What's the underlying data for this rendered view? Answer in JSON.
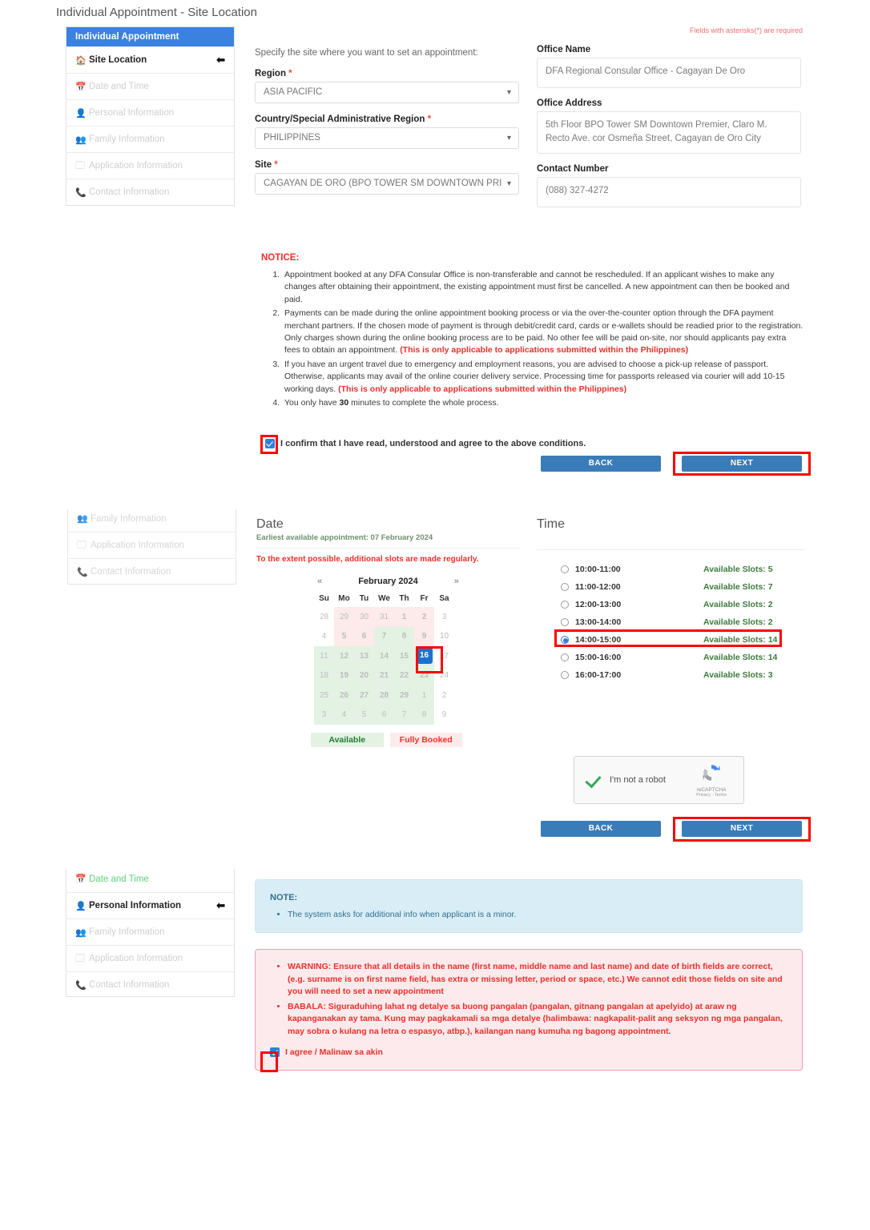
{
  "page": {
    "title": "Individual Appointment - Site Location",
    "required_note": "Fields with asterisks(*) are required"
  },
  "sidebar": {
    "header": "Individual Appointment",
    "items": [
      {
        "label": "Site Location",
        "icon": "home-icon",
        "state": "active"
      },
      {
        "label": "Date and Time",
        "icon": "calendar-icon",
        "state": "disabled"
      },
      {
        "label": "Personal Information",
        "icon": "user-icon",
        "state": "disabled"
      },
      {
        "label": "Family Information",
        "icon": "family-icon",
        "state": "disabled"
      },
      {
        "label": "Application Information",
        "icon": "card-icon",
        "state": "disabled"
      },
      {
        "label": "Contact Information",
        "icon": "phone-icon",
        "state": "disabled"
      }
    ]
  },
  "sidebar2": {
    "items": [
      {
        "label": "Family Information",
        "icon": "family-icon",
        "state": "disabled"
      },
      {
        "label": "Application Information",
        "icon": "card-icon",
        "state": "disabled"
      },
      {
        "label": "Contact Information",
        "icon": "phone-icon",
        "state": "disabled"
      }
    ]
  },
  "sidebar3": {
    "items": [
      {
        "label": "Date and Time",
        "icon": "calendar-icon",
        "state": "done"
      },
      {
        "label": "Personal Information",
        "icon": "user-icon",
        "state": "active"
      },
      {
        "label": "Family Information",
        "icon": "family-icon",
        "state": "disabled"
      },
      {
        "label": "Application Information",
        "icon": "card-icon",
        "state": "disabled"
      },
      {
        "label": "Contact Information",
        "icon": "phone-icon",
        "state": "disabled"
      }
    ]
  },
  "site_form": {
    "intro": "Specify the site where you want to set an appointment:",
    "region_label": "Region",
    "region_value": "ASIA PACIFIC",
    "country_label": "Country/Special Administrative Region",
    "country_value": "PHILIPPINES",
    "site_label": "Site",
    "site_value": "CAGAYAN DE ORO (BPO TOWER SM DOWNTOWN PRI",
    "office_name_label": "Office Name",
    "office_name_value": "DFA Regional Consular Office - Cagayan De Oro",
    "office_address_label": "Office Address",
    "office_address_value": "5th Floor BPO Tower SM Downtown Premier, Claro M. Recto Ave. cor Osmeña Street, Cagayan de Oro City",
    "contact_number_label": "Contact Number",
    "contact_number_value": "(088) 327-4272"
  },
  "notice": {
    "title": "NOTICE:",
    "item1": "Appointment booked at any DFA Consular Office is non-transferable and cannot be rescheduled. If an applicant wishes to make any changes after obtaining their appointment, the existing appointment must first be cancelled. A new appointment can then be booked and paid.",
    "item2_a": "Payments can be made during the online appointment booking process or via the over-the-counter option through the DFA payment merchant partners. If the chosen mode of payment is through debit/credit card, cards or e-wallets should be readied prior to the registration. Only charges shown during the online booking process are to be paid. No other fee will be paid on-site, nor should applicants pay extra fees to obtain an appointment. ",
    "item2_b": "(This is only applicable to applications submitted within the Philippines)",
    "item3_a": "If you have an urgent travel due to emergency and employment reasons, you are advised to choose a pick-up release of passport. Otherwise, applicants may avail of the online courier delivery service. Processing time for passports released via courier will add 10-15 working days. ",
    "item3_b": "(This is only applicable to applications submitted within the Philippines)",
    "item4_a": "You only have ",
    "item4_b": "30",
    "item4_c": " minutes to complete the whole process.",
    "confirm_label": "I confirm that I have read, understood and agree to the above conditions.",
    "back_label": "BACK",
    "next_label": "NEXT"
  },
  "date_section": {
    "heading": "Date",
    "earliest": "Earliest available appointment: 07 February 2024",
    "slots_note": "To the extent possible, additional slots are made regularly.",
    "prev": "«",
    "next": "»",
    "month": "February 2024",
    "weekdays": [
      "Su",
      "Mo",
      "Tu",
      "We",
      "Th",
      "Fr",
      "Sa"
    ],
    "legend_available": "Available",
    "legend_fully_booked": "Fully Booked",
    "weeks": [
      [
        {
          "d": "28",
          "t": "out"
        },
        {
          "d": "29",
          "t": "fbd"
        },
        {
          "d": "30",
          "t": "fbd"
        },
        {
          "d": "31",
          "t": "fbd"
        },
        {
          "d": "1",
          "t": "fb"
        },
        {
          "d": "2",
          "t": "fb"
        },
        {
          "d": "3",
          "t": "out"
        }
      ],
      [
        {
          "d": "4",
          "t": "out"
        },
        {
          "d": "5",
          "t": "fb"
        },
        {
          "d": "6",
          "t": "fb"
        },
        {
          "d": "7",
          "t": "av"
        },
        {
          "d": "8",
          "t": "av"
        },
        {
          "d": "9",
          "t": "fb"
        },
        {
          "d": "10",
          "t": "out"
        }
      ],
      [
        {
          "d": "11",
          "t": "avd"
        },
        {
          "d": "12",
          "t": "av"
        },
        {
          "d": "13",
          "t": "av"
        },
        {
          "d": "14",
          "t": "av"
        },
        {
          "d": "15",
          "t": "av"
        },
        {
          "d": "16",
          "t": "sel"
        },
        {
          "d": "17",
          "t": "out"
        }
      ],
      [
        {
          "d": "18",
          "t": "avd"
        },
        {
          "d": "19",
          "t": "av"
        },
        {
          "d": "20",
          "t": "av"
        },
        {
          "d": "21",
          "t": "av"
        },
        {
          "d": "22",
          "t": "av"
        },
        {
          "d": "23",
          "t": "av"
        },
        {
          "d": "24",
          "t": "out"
        }
      ],
      [
        {
          "d": "25",
          "t": "avd"
        },
        {
          "d": "26",
          "t": "av"
        },
        {
          "d": "27",
          "t": "av"
        },
        {
          "d": "28",
          "t": "av"
        },
        {
          "d": "29",
          "t": "av"
        },
        {
          "d": "1",
          "t": "avd"
        },
        {
          "d": "2",
          "t": "out"
        }
      ],
      [
        {
          "d": "3",
          "t": "avd"
        },
        {
          "d": "4",
          "t": "avd"
        },
        {
          "d": "5",
          "t": "avd"
        },
        {
          "d": "6",
          "t": "avd"
        },
        {
          "d": "7",
          "t": "avd"
        },
        {
          "d": "8",
          "t": "avd"
        },
        {
          "d": "9",
          "t": "out"
        }
      ]
    ]
  },
  "time_section": {
    "heading": "Time",
    "slots": [
      {
        "time": "10:00-11:00",
        "available": "Available Slots: 5",
        "selected": false
      },
      {
        "time": "11:00-12:00",
        "available": "Available Slots: 7",
        "selected": false
      },
      {
        "time": "12:00-13:00",
        "available": "Available Slots: 2",
        "selected": false
      },
      {
        "time": "13:00-14:00",
        "available": "Available Slots: 2",
        "selected": false
      },
      {
        "time": "14:00-15:00",
        "available": "Available Slots: 14",
        "selected": true
      },
      {
        "time": "15:00-16:00",
        "available": "Available Slots: 14",
        "selected": false
      },
      {
        "time": "16:00-17:00",
        "available": "Available Slots: 3",
        "selected": false
      }
    ],
    "recaptcha_label": "I'm not a robot",
    "recaptcha_brand": "reCAPTCHA",
    "recaptcha_terms": "Privacy - Terms",
    "back_label": "BACK",
    "next_label": "NEXT"
  },
  "personal_section": {
    "note_title": "NOTE:",
    "note_item": "The system asks for additional info when applicant is a minor.",
    "warning_en": "WARNING: Ensure that all details in the name (first name, middle name and last name) and date of birth fields are correct, (e.g. surname is on first name field, has extra or missing letter, period or space, etc.) We cannot edit those fields on site and you will need to set a new appointment",
    "warning_tl": "BABALA: Siguraduhing lahat ng detalye sa buong pangalan (pangalan, gitnang pangalan at apelyido) at araw ng kapanganakan ay tama. Kung may pagkakamali sa mga detalye (halimbawa: nagkapalit-palit ang seksyon ng mga pangalan, may sobra o kulang na letra o espasyo, atbp.), kailangan nang kumuha ng bagong appointment.",
    "agree_label": "I agree / Malinaw sa akin"
  },
  "colors": {
    "brand_blue": "#3b82e0",
    "button_blue": "#3a7cb8",
    "highlight_red": "#ff0000",
    "available_green": "#1e7d32",
    "booked_red": "#ef3b3b"
  }
}
